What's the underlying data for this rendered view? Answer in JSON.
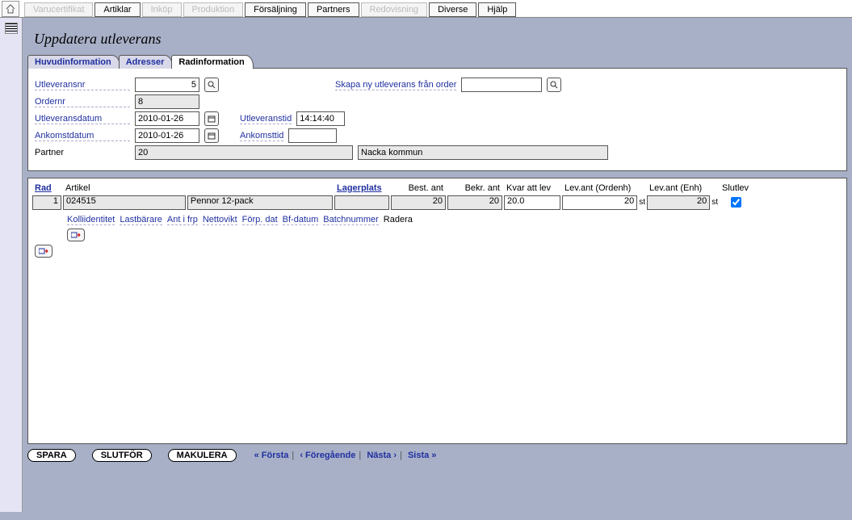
{
  "menu": {
    "items": [
      {
        "label": "Varucertifikat",
        "disabled": true
      },
      {
        "label": "Artiklar",
        "disabled": false
      },
      {
        "label": "Inköp",
        "disabled": true
      },
      {
        "label": "Produktion",
        "disabled": true
      },
      {
        "label": "Försäljning",
        "disabled": false
      },
      {
        "label": "Partners",
        "disabled": false
      },
      {
        "label": "Redovisning",
        "disabled": true
      },
      {
        "label": "Diverse",
        "disabled": false
      },
      {
        "label": "Hjälp",
        "disabled": false
      }
    ]
  },
  "page": {
    "title": "Uppdatera utleverans"
  },
  "subtabs": [
    {
      "label": "Huvudinformation"
    },
    {
      "label": "Adresser"
    },
    {
      "label": "Radinformation",
      "active": true
    }
  ],
  "form": {
    "labels": {
      "utleveransnr": "Utleveransnr",
      "ordernr": "Ordernr",
      "utleveransdatum": "Utleveransdatum",
      "utleveranstid": "Utleveranstid",
      "ankomstdatum": "Ankomstdatum",
      "ankomsttid": "Ankomsttid",
      "partner": "Partner",
      "skapa": "Skapa ny utleverans från order"
    },
    "values": {
      "utleveransnr": "5",
      "ordernr": "8",
      "utleveransdatum": "2010-01-26",
      "utleveranstid": "14:14:40",
      "ankomstdatum": "2010-01-26",
      "ankomsttid": "",
      "partner_code": "20",
      "partner_name": "Nacka kommun",
      "skapa": ""
    }
  },
  "grid": {
    "headers": [
      "Rad",
      "Artikel",
      "Lagerplats",
      "Best. ant",
      "Bekr. ant",
      "Kvar att lev",
      "Lev.ant (Ordenh)",
      "Lev.ant (Enh)",
      "Slutlev"
    ],
    "row": {
      "rad": "1",
      "artnr": "024515",
      "artname": "Pennor 12-pack",
      "lager": "",
      "best": "20",
      "bekr": "20",
      "kvar": "20.0",
      "lev_ord": "20",
      "lev_ord_unit": "st",
      "lev_enh": "20",
      "lev_enh_unit": "st",
      "slutlev": true
    },
    "subheaders": [
      "Kolliidentitet",
      "Lastbärare",
      "Ant i frp",
      "Nettovikt",
      "Förp. dat",
      "Bf-datum",
      "Batchnummer",
      "Radera"
    ]
  },
  "footer": {
    "buttons": [
      "SPARA",
      "SLUTFÖR",
      "MAKULERA"
    ],
    "pager": [
      "« Första",
      "‹ Föregående",
      "Nästa ›",
      "Sista »"
    ]
  }
}
